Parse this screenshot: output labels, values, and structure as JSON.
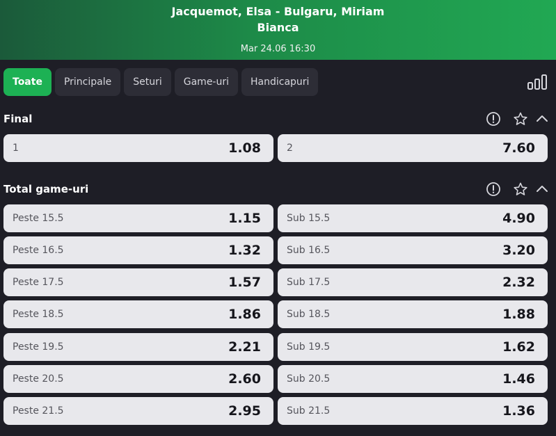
{
  "header": {
    "title_line1": "Jacquemot, Elsa - Bulgaru, Miriam",
    "title_line2": "Bianca",
    "datetime": "Mar 24.06 16:30"
  },
  "tabs": [
    {
      "label": "Toate",
      "active": true
    },
    {
      "label": "Principale",
      "active": false
    },
    {
      "label": "Seturi",
      "active": false
    },
    {
      "label": "Game-uri",
      "active": false
    },
    {
      "label": "Handicapuri",
      "active": false
    }
  ],
  "icons": {
    "stats": "bar-chart-icon",
    "info": "info-icon",
    "favorite": "star-icon",
    "collapse": "chevron-up-icon"
  },
  "colors": {
    "accent": "#1db154",
    "background": "#1e1e26",
    "button": "#e8e8ec"
  },
  "sections": {
    "final": {
      "title": "Final",
      "odds": [
        {
          "label": "1",
          "value": "1.08"
        },
        {
          "label": "2",
          "value": "7.60"
        }
      ]
    },
    "total_games": {
      "title": "Total game-uri",
      "rows": [
        {
          "over_label": "Peste 15.5",
          "over_value": "1.15",
          "under_label": "Sub 15.5",
          "under_value": "4.90"
        },
        {
          "over_label": "Peste 16.5",
          "over_value": "1.32",
          "under_label": "Sub 16.5",
          "under_value": "3.20"
        },
        {
          "over_label": "Peste 17.5",
          "over_value": "1.57",
          "under_label": "Sub 17.5",
          "under_value": "2.32"
        },
        {
          "over_label": "Peste 18.5",
          "over_value": "1.86",
          "under_label": "Sub 18.5",
          "under_value": "1.88"
        },
        {
          "over_label": "Peste 19.5",
          "over_value": "2.21",
          "under_label": "Sub 19.5",
          "under_value": "1.62"
        },
        {
          "over_label": "Peste 20.5",
          "over_value": "2.60",
          "under_label": "Sub 20.5",
          "under_value": "1.46"
        },
        {
          "over_label": "Peste 21.5",
          "over_value": "2.95",
          "under_label": "Sub 21.5",
          "under_value": "1.36"
        }
      ]
    }
  }
}
